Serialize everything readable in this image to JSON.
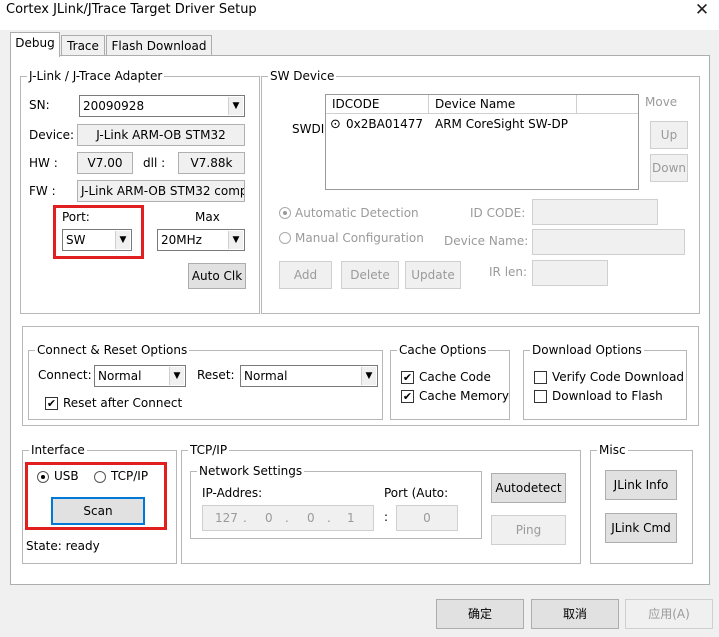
{
  "window": {
    "title": "Cortex JLink/JTrace Target Driver Setup",
    "close_glyph": "✕"
  },
  "tabs": [
    {
      "label": "Debug"
    },
    {
      "label": "Trace"
    },
    {
      "label": "Flash Download"
    }
  ],
  "adapter": {
    "group_label": "J-Link / J-Trace Adapter",
    "sn_label": "SN:",
    "sn_value": "20090928",
    "device_label": "Device:",
    "device_value": "J-Link ARM-OB STM32",
    "hw_label": "HW :",
    "hw_value": "V7.00",
    "dll_label": "dll :",
    "dll_value": "V7.88k",
    "fw_label": "FW :",
    "fw_value": "J-Link ARM-OB STM32 comp",
    "port_label": "Port:",
    "port_value": "SW",
    "max_label": "Max",
    "max_value": "20MHz",
    "auto_clk_label": "Auto Clk"
  },
  "sw_device": {
    "group_label": "SW Device",
    "swdi_label": "SWDI",
    "columns": [
      "IDCODE",
      "Device Name"
    ],
    "rows": [
      {
        "idcode": "0x2BA01477",
        "device_name": "ARM CoreSight SW-DP"
      }
    ],
    "move_label": "Move",
    "up_label": "Up",
    "down_label": "Down",
    "auto_detect_label": "Automatic Detection",
    "manual_config_label": "Manual Configuration",
    "id_code_label": "ID CODE:",
    "device_name_label": "Device Name:",
    "ir_len_label": "IR len:",
    "add_label": "Add",
    "delete_label": "Delete",
    "update_label": "Update"
  },
  "connect_reset": {
    "group_label": "Connect & Reset Options",
    "connect_label": "Connect:",
    "connect_value": "Normal",
    "reset_label": "Reset:",
    "reset_value": "Normal",
    "reset_after_connect_label": "Reset after Connect"
  },
  "cache": {
    "group_label": "Cache Options",
    "cache_code_label": "Cache Code",
    "cache_memory_label": "Cache Memory"
  },
  "download": {
    "group_label": "Download Options",
    "verify_label": "Verify Code Download",
    "download_flash_label": "Download to Flash"
  },
  "interface": {
    "group_label": "Interface",
    "usb_label": "USB",
    "tcpip_label": "TCP/IP",
    "scan_label": "Scan",
    "state_label": "State: ready"
  },
  "tcpip": {
    "group_label": "TCP/IP",
    "network_label": "Network Settings",
    "ip_label": "IP-Addres:",
    "ip_octets": [
      "127",
      "0",
      "0",
      "1"
    ],
    "port_label": "Port (Auto:",
    "port_value": "0",
    "autodetect_label": "Autodetect",
    "ping_label": "Ping"
  },
  "misc": {
    "group_label": "Misc",
    "jlink_info_label": "JLink Info",
    "jlink_cmd_label": "JLink Cmd"
  },
  "footer": {
    "ok_label": "确定",
    "cancel_label": "取消",
    "apply_label": "应用(A)"
  },
  "icons": {
    "dropdown": "▼",
    "checkmark": "✔",
    "selected_row": "⊙"
  }
}
